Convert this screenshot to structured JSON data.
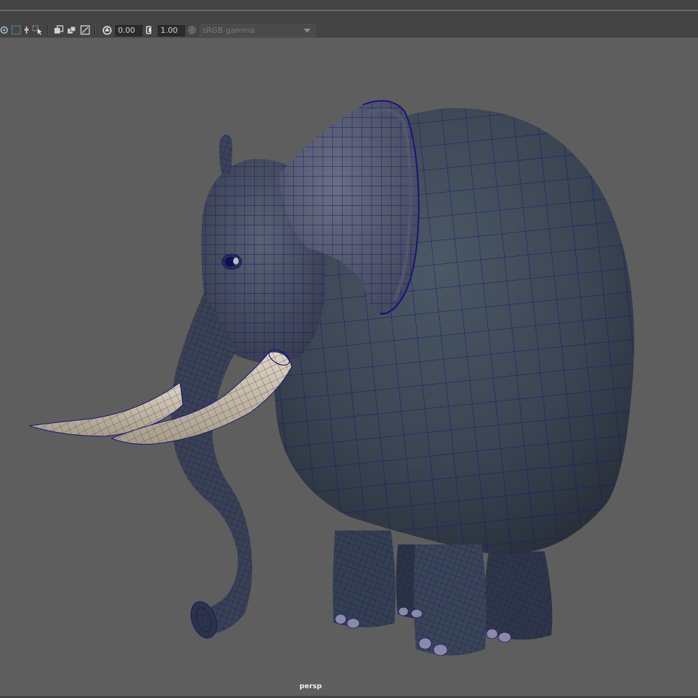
{
  "toolbar": {
    "exposure_value": "0.00",
    "gamma_value": "1.00",
    "color_space": "sRGB gamma",
    "icons": [
      "isolate-select-icon",
      "grid-icon",
      "camera-attr-icon",
      "select-camera-icon",
      "film-gate-icon",
      "resolution-gate-icon",
      "safe-action-icon",
      "exposure-icon",
      "gamma-icon",
      "color-management-icon"
    ]
  },
  "viewport": {
    "camera_name": "persp",
    "background_color": "#5e5e5e",
    "mesh_color": "#3a4452",
    "wire_color": "#14147a",
    "tusk_color": "#c8bba6"
  }
}
